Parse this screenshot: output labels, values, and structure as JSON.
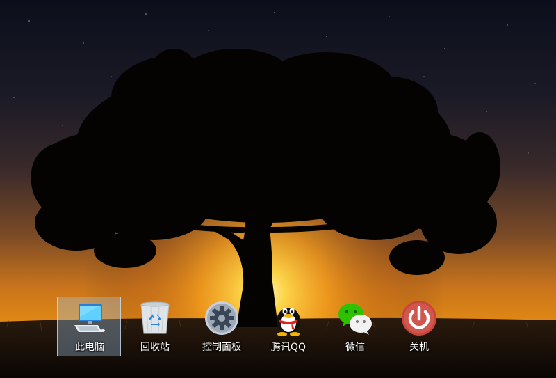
{
  "desktop": {
    "wallpaper": "tree-sunset-wallpaper",
    "icons": [
      {
        "label": "此电脑",
        "icon": "computer-icon",
        "selected": true
      },
      {
        "label": "回收站",
        "icon": "recycle-bin-icon",
        "selected": false
      },
      {
        "label": "控制面板",
        "icon": "control-panel-gear-icon",
        "selected": false
      },
      {
        "label": "腾讯QQ",
        "icon": "qq-penguin-icon",
        "selected": false
      },
      {
        "label": "微信",
        "icon": "wechat-icon",
        "selected": false
      },
      {
        "label": "关机",
        "icon": "power-icon",
        "selected": false
      }
    ]
  },
  "colors": {
    "selection_fill": "#a0c8eb",
    "power_red": "#c8453e",
    "wechat_green": "#2dc100",
    "sun_glow": "#ffb627"
  }
}
